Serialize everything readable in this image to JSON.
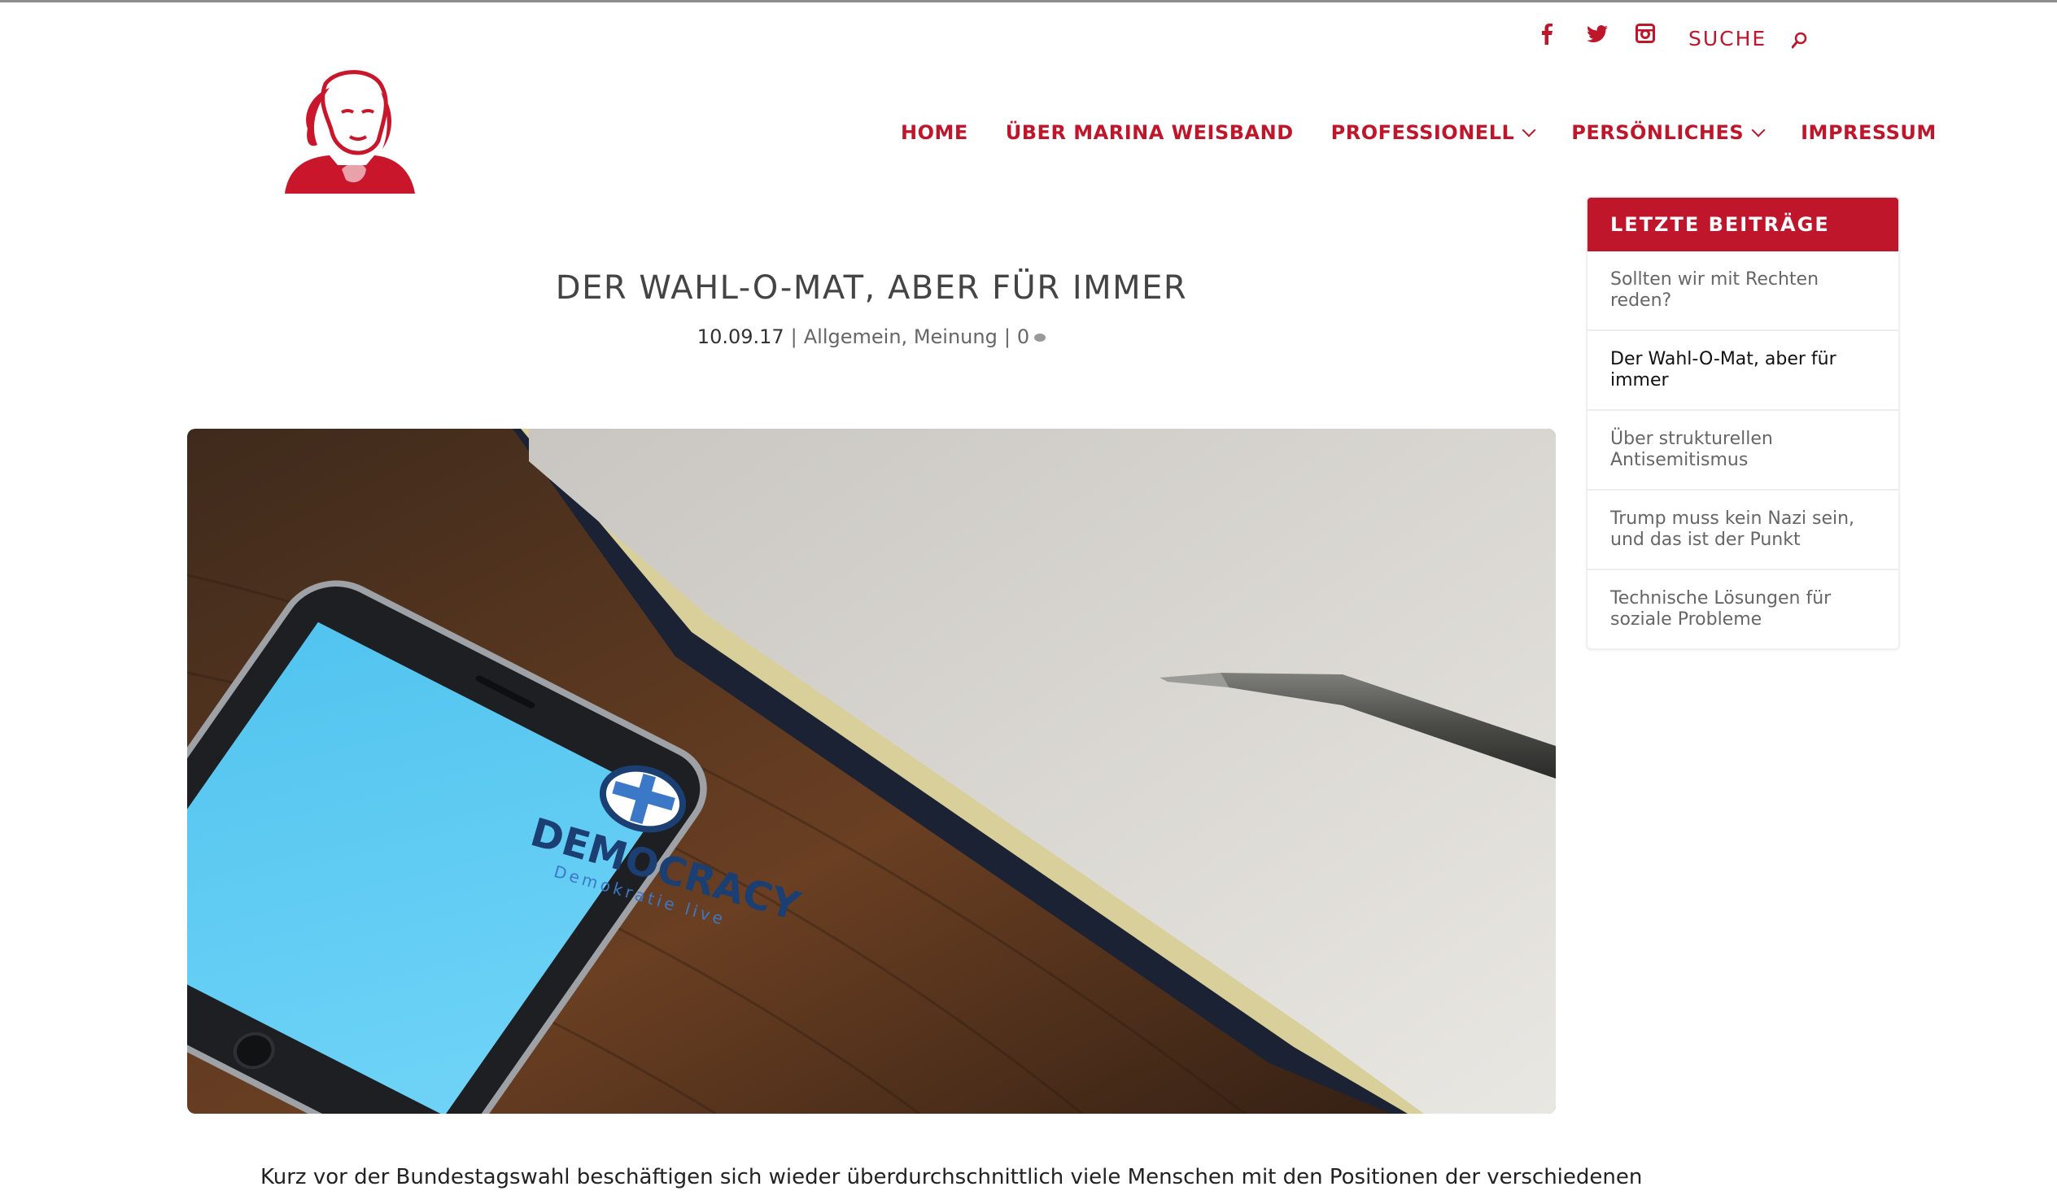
{
  "topbar": {
    "social_icons": [
      "facebook-icon",
      "twitter-icon",
      "instagram-icon"
    ],
    "search_label": "SUCHE",
    "search_icon": "search-icon"
  },
  "colors": {
    "brand_red": "#c0162b",
    "title_gray": "#444444",
    "meta_gray": "#666666"
  },
  "nav": {
    "items": [
      {
        "label": "HOME",
        "has_dropdown": false
      },
      {
        "label": "ÜBER MARINA WEISBAND",
        "has_dropdown": false
      },
      {
        "label": "PROFESSIONELL",
        "has_dropdown": true
      },
      {
        "label": "PERSÖNLICHES",
        "has_dropdown": true
      },
      {
        "label": "IMPRESSUM",
        "has_dropdown": false
      }
    ]
  },
  "post": {
    "title": "DER WAHL-O-MAT, ABER FÜR IMMER",
    "date": "10.09.17",
    "category_1": "Allgemein",
    "category_2": "Meinung",
    "comments": "0",
    "image_text_brand": "DEMOCRACY",
    "image_text_sub": "Demokratie live",
    "excerpt_line_1": "Kurz vor der Bundestagswahl beschäftigen sich wieder überdurchschnittlich viele Menschen mit den Positionen der verschiedenen"
  },
  "sidebar": {
    "title": "LETZTE BEITRÄGE",
    "items": [
      {
        "label": "Sollten wir mit Rechten reden?",
        "active": false
      },
      {
        "label": "Der Wahl-O-Mat, aber für immer",
        "active": true
      },
      {
        "label": "Über strukturellen Antisemitismus",
        "active": false
      },
      {
        "label": "Trump muss kein Nazi sein, und das ist der Punkt",
        "active": false
      },
      {
        "label": "Technische Lösungen für soziale Probleme",
        "active": false
      }
    ]
  }
}
